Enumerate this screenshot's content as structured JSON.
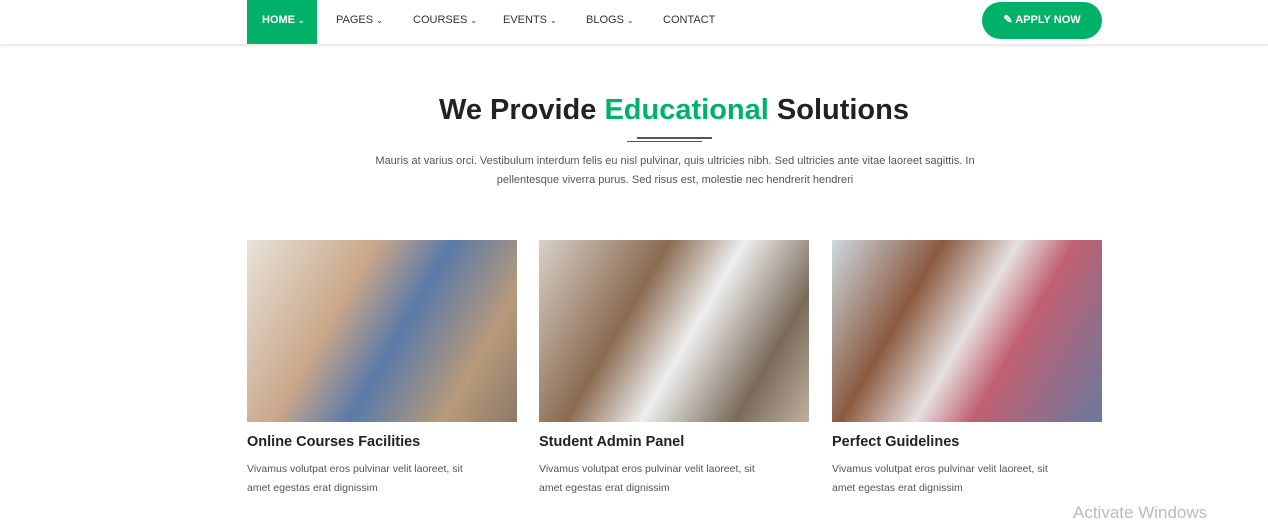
{
  "nav": {
    "items": [
      {
        "label": "HOME",
        "dropdown": true
      },
      {
        "label": "PAGES",
        "dropdown": true
      },
      {
        "label": "COURSES",
        "dropdown": true
      },
      {
        "label": "EVENTS",
        "dropdown": true
      },
      {
        "label": "BLOGS",
        "dropdown": true
      },
      {
        "label": "CONTACT",
        "dropdown": false
      }
    ],
    "apply_label": "APPLY NOW",
    "accent": "#00b16a"
  },
  "section": {
    "title_a": "We Provide ",
    "title_b": "Educational",
    "title_c": " Solutions",
    "intro": "Mauris at varius orci. Vestibulum interdum felis eu nisl pulvinar, quis ultricies nibh. Sed ultricies ante vitae laoreet sagittis. In pellentesque viverra purus. Sed risus est, molestie nec hendrerit hendreri"
  },
  "cards": [
    {
      "title": "Online Courses Facilities",
      "text": "Vivamus volutpat eros pulvinar velit laoreet, sit amet egestas erat dignissim"
    },
    {
      "title": "Student Admin Panel",
      "text": "Vivamus volutpat eros pulvinar velit laoreet, sit amet egestas erat dignissim"
    },
    {
      "title": "Perfect Guidelines",
      "text": "Vivamus volutpat eros pulvinar velit laoreet, sit amet egestas erat dignissim"
    }
  ],
  "watermark": "Activate Windows"
}
